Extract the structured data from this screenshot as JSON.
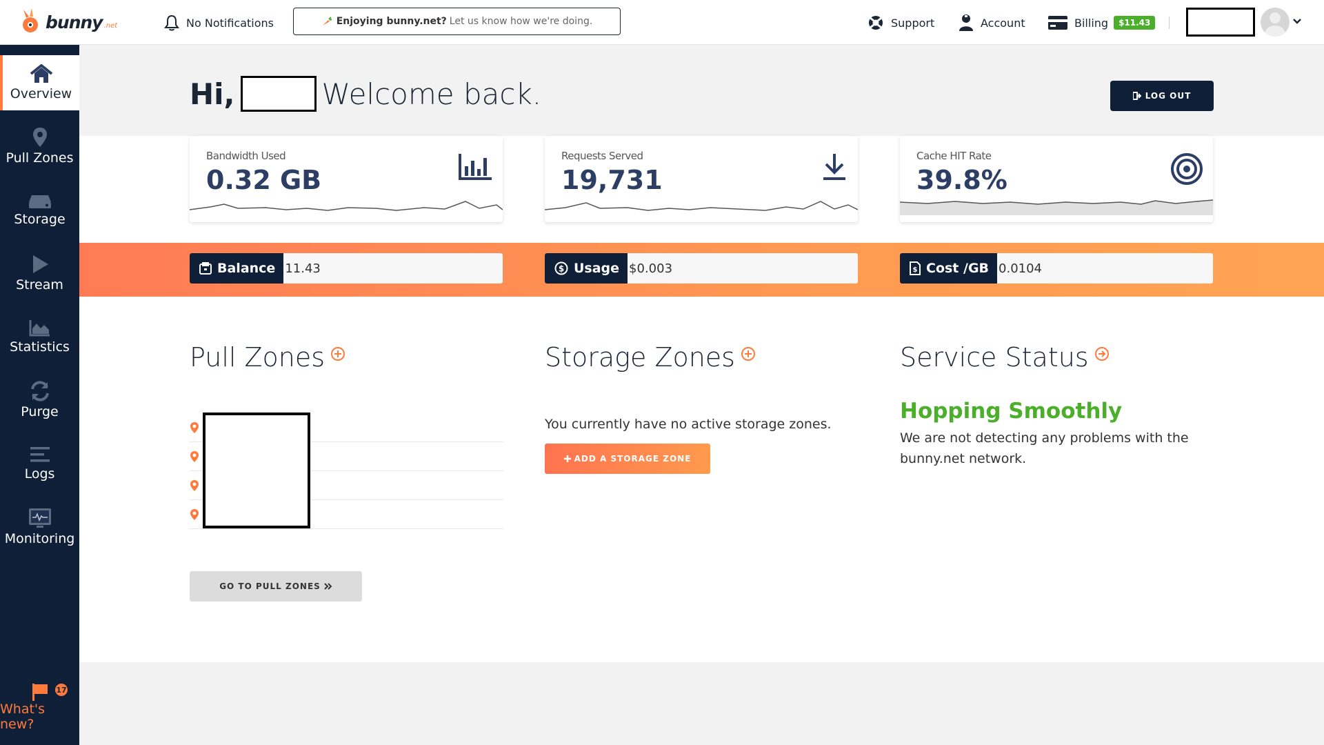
{
  "brand": {
    "name": "bunny",
    "tld": ".net",
    "accent": "#ff7a3d",
    "navy": "#0f1f38",
    "green": "#4caf2b"
  },
  "topbar": {
    "notifications": "No Notifications",
    "feedback_bold": "Enjoying bunny.net?",
    "feedback_text": "Let us know how we're doing.",
    "support": "Support",
    "account": "Account",
    "billing": "Billing",
    "credit": "$11.43"
  },
  "sidebar": {
    "items": [
      {
        "label": "Overview",
        "icon": "home-icon"
      },
      {
        "label": "Pull Zones",
        "icon": "map-pin-icon"
      },
      {
        "label": "Storage",
        "icon": "drive-icon"
      },
      {
        "label": "Stream",
        "icon": "play-icon"
      },
      {
        "label": "Statistics",
        "icon": "area-chart-icon"
      },
      {
        "label": "Purge",
        "icon": "refresh-icon"
      },
      {
        "label": "Logs",
        "icon": "list-icon"
      },
      {
        "label": "Monitoring",
        "icon": "monitor-icon"
      }
    ],
    "whats_new": "What's new?",
    "whats_new_count": "17"
  },
  "header": {
    "hi": "Hi,",
    "welcome": "Welcome back.",
    "logout": "LOG OUT"
  },
  "stats": [
    {
      "label": "Bandwidth Used",
      "value": "0.32 GB",
      "icon": "bar-chart-icon"
    },
    {
      "label": "Requests Served",
      "value": "19,731",
      "icon": "download-icon"
    },
    {
      "label": "Cache HIT Rate",
      "value": "39.8%",
      "icon": "target-icon"
    }
  ],
  "billing_pills": [
    {
      "label": "Balance",
      "value": "11.43",
      "icon": "wallet-icon"
    },
    {
      "label": "Usage",
      "value": "$0.003",
      "icon": "dollar-circle-icon"
    },
    {
      "label": "Cost /GB",
      "value": "0.0104",
      "icon": "invoice-icon"
    }
  ],
  "sections": {
    "pull_zones": {
      "title": "Pull Zones",
      "button": "GO TO PULL ZONES"
    },
    "storage_zones": {
      "title": "Storage Zones",
      "empty_text": "You currently have no active storage zones.",
      "button": "ADD A STORAGE ZONE"
    },
    "service_status": {
      "title": "Service Status",
      "headline": "Hopping Smoothly",
      "text": "We are not detecting any problems with the bunny.net network."
    }
  }
}
